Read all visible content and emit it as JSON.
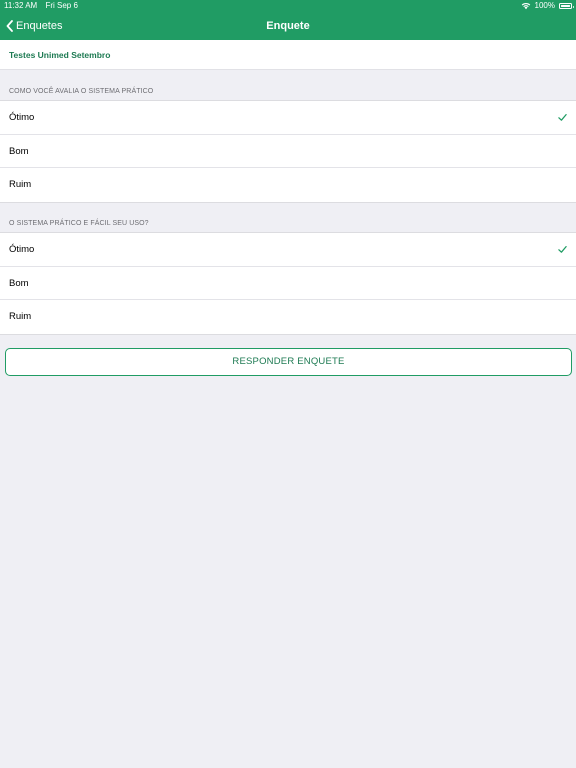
{
  "status_bar": {
    "time": "11:32 AM",
    "date": "Fri Sep 6",
    "battery": "100%"
  },
  "navbar": {
    "back_label": "Enquetes",
    "title": "Enquete"
  },
  "survey": {
    "title": "Testes Unimed Setembro",
    "questions": [
      {
        "header": "COMO VOCÊ AVALIA O SISTEMA PRÁTICO",
        "options": [
          {
            "label": "Ótimo",
            "selected": true
          },
          {
            "label": "Bom",
            "selected": false
          },
          {
            "label": "Ruim",
            "selected": false
          }
        ]
      },
      {
        "header": "O SISTEMA PRÁTICO E FÁCIL SEU USO?",
        "options": [
          {
            "label": "Ótimo",
            "selected": true
          },
          {
            "label": "Bom",
            "selected": false
          },
          {
            "label": "Ruim",
            "selected": false
          }
        ]
      }
    ],
    "submit_label": "RESPONDER ENQUETE"
  },
  "colors": {
    "accent": "#209c64",
    "accent_text": "#1d7a52",
    "background": "#efeff4"
  }
}
